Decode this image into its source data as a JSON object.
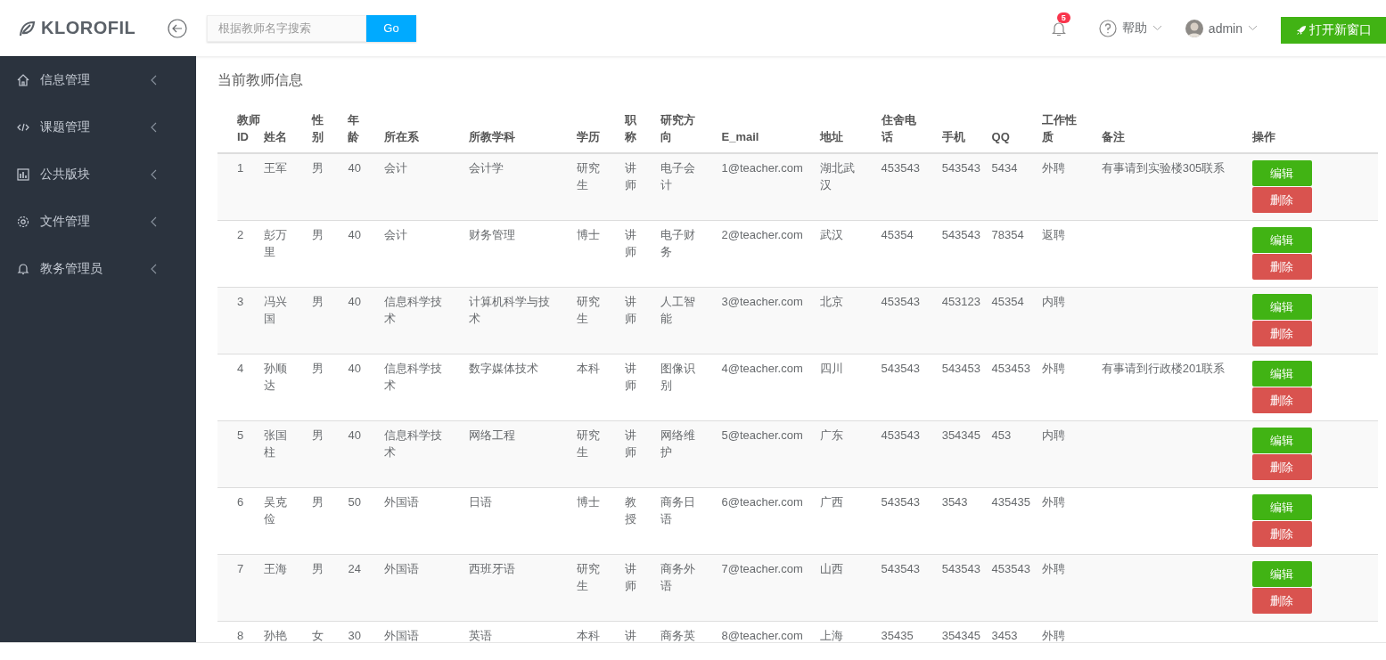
{
  "header": {
    "logo": "KLOROFIL",
    "search": {
      "placeholder": "根据教师名字搜索",
      "button": "Go"
    },
    "notifications": "5",
    "help": "帮助",
    "user": "admin",
    "open_window": "打开新窗口"
  },
  "sidebar": {
    "items": [
      {
        "label": "信息管理"
      },
      {
        "label": "课题管理"
      },
      {
        "label": "公共版块"
      },
      {
        "label": "文件管理"
      },
      {
        "label": "教务管理员"
      }
    ]
  },
  "page_title": "当前教师信息",
  "table": {
    "columns": [
      "教师ID",
      "姓名",
      "性别",
      "年龄",
      "所在系",
      "所教学科",
      "学历",
      "职称",
      "研究方向",
      "E_mail",
      "地址",
      "住舍电话",
      "手机",
      "QQ",
      "工作性质",
      "备注",
      "操作"
    ],
    "rows": [
      {
        "cells": [
          "1",
          "王军",
          "男",
          "40",
          "会计",
          "会计学",
          "研究生",
          "讲师",
          "电子会计",
          "1@teacher.com",
          "湖北武汉",
          "453543",
          "543543",
          "5434",
          "外聘",
          "有事请到实验楼305联系"
        ],
        "actions": [
          "编辑",
          "删除"
        ]
      },
      {
        "cells": [
          "2",
          "彭万里",
          "男",
          "40",
          "会计",
          "财务管理",
          "博士",
          "讲师",
          "电子财务",
          "2@teacher.com",
          "武汉",
          "45354",
          "543543",
          "78354",
          "返聘",
          ""
        ],
        "actions": [
          "编辑",
          "删除"
        ]
      },
      {
        "cells": [
          "3",
          "冯兴国",
          "男",
          "40",
          "信息科学技术",
          "计算机科学与技术",
          "研究生",
          "讲师",
          "人工智能",
          "3@teacher.com",
          "北京",
          "453543",
          "453123",
          "45354",
          "内聘",
          ""
        ],
        "actions": [
          "编辑",
          "删除"
        ]
      },
      {
        "cells": [
          "4",
          "孙顺达",
          "男",
          "40",
          "信息科学技术",
          "数字媒体技术",
          "本科",
          "讲师",
          "图像识别",
          "4@teacher.com",
          "四川",
          "543543",
          "543453",
          "453453",
          "外聘",
          "有事请到行政楼201联系"
        ],
        "actions": [
          "编辑",
          "删除"
        ]
      },
      {
        "cells": [
          "5",
          "张国柱",
          "男",
          "40",
          "信息科学技术",
          "网络工程",
          "研究生",
          "讲师",
          "网络维护",
          "5@teacher.com",
          "广东",
          "453543",
          "354345",
          "453",
          "内聘",
          ""
        ],
        "actions": [
          "编辑",
          "删除"
        ]
      },
      {
        "cells": [
          "6",
          "吴克俭",
          "男",
          "50",
          "外国语",
          "日语",
          "博士",
          "教授",
          "商务日语",
          "6@teacher.com",
          "广西",
          "543543",
          "3543",
          "435435",
          "外聘",
          ""
        ],
        "actions": [
          "编辑",
          "删除"
        ]
      },
      {
        "cells": [
          "7",
          "王海",
          "男",
          "24",
          "外国语",
          "西班牙语",
          "研究生",
          "讲师",
          "商务外语",
          "7@teacher.com",
          "山西",
          "543543",
          "543543",
          "453543",
          "外聘",
          ""
        ],
        "actions": [
          "编辑",
          "删除"
        ]
      },
      {
        "cells": [
          "8",
          "孙艳",
          "女",
          "30",
          "外国语",
          "英语",
          "本科",
          "讲",
          "商务英",
          "8@teacher.com",
          "上海",
          "35435",
          "354345",
          "3453",
          "外聘",
          ""
        ],
        "actions": []
      }
    ]
  }
}
